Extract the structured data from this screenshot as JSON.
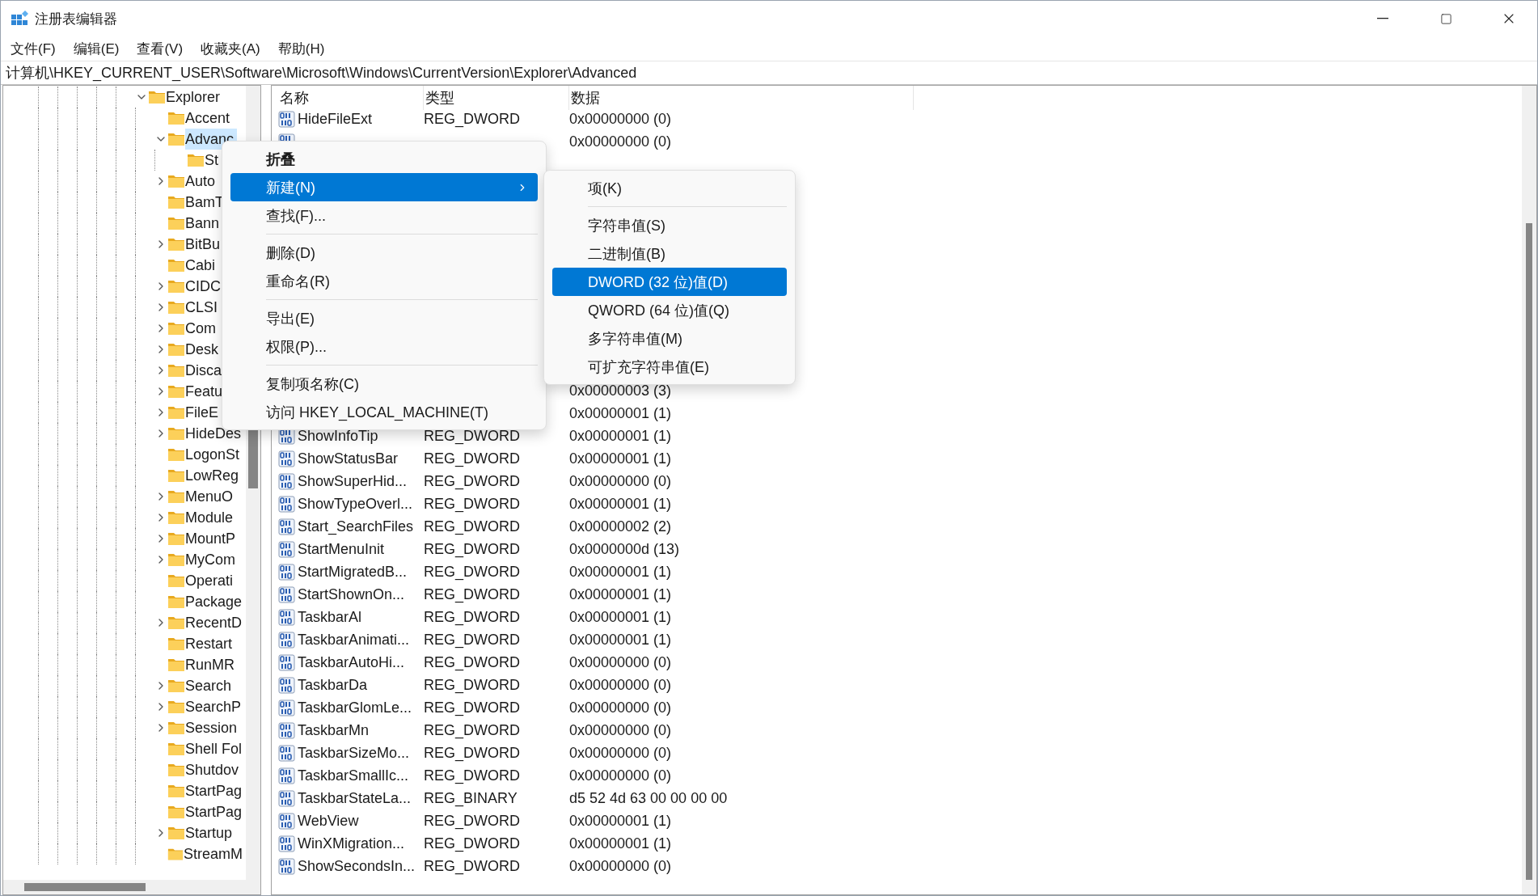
{
  "window": {
    "title": "注册表编辑器"
  },
  "menu_bar": [
    "文件(F)",
    "编辑(E)",
    "查看(V)",
    "收藏夹(A)",
    "帮助(H)"
  ],
  "address": "计算机\\HKEY_CURRENT_USER\\Software\\Microsoft\\Windows\\CurrentVersion\\Explorer\\Advanced",
  "tree": [
    {
      "label": "Explorer",
      "expanded": true,
      "selected": false,
      "children": [
        {
          "label": "Accent",
          "selected": false
        },
        {
          "label": "Advanc",
          "expanded": true,
          "selected": true,
          "children": [
            {
              "label": "St",
              "selected": false
            }
          ]
        },
        {
          "label": "Auto",
          "expanded": false,
          "selected": false
        },
        {
          "label": "BamT",
          "selected": false
        },
        {
          "label": "Bann",
          "selected": false
        },
        {
          "label": "BitBu",
          "expanded": false,
          "selected": false
        },
        {
          "label": "Cabi",
          "selected": false
        },
        {
          "label": "CIDC",
          "expanded": false,
          "selected": false
        },
        {
          "label": "CLSI",
          "expanded": false,
          "selected": false
        },
        {
          "label": "Com",
          "expanded": false,
          "selected": false
        },
        {
          "label": "Desk",
          "expanded": false,
          "selected": false
        },
        {
          "label": "Disca",
          "expanded": false,
          "selected": false
        },
        {
          "label": "Featu",
          "expanded": false,
          "selected": false
        },
        {
          "label": "FileE",
          "expanded": false,
          "selected": false
        },
        {
          "label": "HideDes",
          "expanded": false,
          "selected": false
        },
        {
          "label": "LogonSt",
          "selected": false
        },
        {
          "label": "LowReg",
          "selected": false
        },
        {
          "label": "MenuO",
          "expanded": false,
          "selected": false
        },
        {
          "label": "Module",
          "expanded": false,
          "selected": false
        },
        {
          "label": "MountP",
          "expanded": false,
          "selected": false
        },
        {
          "label": "MyCom",
          "expanded": false,
          "selected": false
        },
        {
          "label": "Operati",
          "selected": false
        },
        {
          "label": "Package",
          "selected": false
        },
        {
          "label": "RecentD",
          "expanded": false,
          "selected": false
        },
        {
          "label": "Restart",
          "selected": false
        },
        {
          "label": "RunMR",
          "selected": false
        },
        {
          "label": "Search",
          "expanded": false,
          "selected": false
        },
        {
          "label": "SearchP",
          "expanded": false,
          "selected": false
        },
        {
          "label": "Session",
          "expanded": false,
          "selected": false
        },
        {
          "label": "Shell Fol",
          "selected": false
        },
        {
          "label": "Shutdov",
          "selected": false
        },
        {
          "label": "StartPag",
          "selected": false
        },
        {
          "label": "StartPag",
          "selected": false
        },
        {
          "label": "Startup",
          "expanded": false,
          "selected": false
        },
        {
          "label": "StreamM",
          "selected": false
        }
      ]
    }
  ],
  "table": {
    "columns": [
      "名称",
      "类型",
      "数据"
    ],
    "rows": [
      {
        "icon": true,
        "name": "HideFileExt",
        "type": "REG_DWORD",
        "data": "0x00000000 (0)"
      },
      {
        "icon": true,
        "data": "0x00000000 (0)"
      },
      {
        "icon": false
      },
      {
        "icon": false
      },
      {
        "icon": false
      },
      {
        "icon": false
      },
      {
        "icon": false
      },
      {
        "icon": false
      },
      {
        "icon": false
      },
      {
        "icon": false
      },
      {
        "icon": false
      },
      {
        "icon": false
      },
      {
        "icon": false,
        "data": "0x00000003 (3)"
      },
      {
        "icon": false,
        "data": "0x00000001 (1)"
      },
      {
        "icon": true,
        "name": "ShowInfoTip",
        "type": "REG_DWORD",
        "data": "0x00000001 (1)"
      },
      {
        "icon": true,
        "name": "ShowStatusBar",
        "type": "REG_DWORD",
        "data": "0x00000001 (1)"
      },
      {
        "icon": true,
        "name": "ShowSuperHid...",
        "type": "REG_DWORD",
        "data": "0x00000000 (0)"
      },
      {
        "icon": true,
        "name": "ShowTypeOverl...",
        "type": "REG_DWORD",
        "data": "0x00000001 (1)"
      },
      {
        "icon": true,
        "name": "Start_SearchFiles",
        "type": "REG_DWORD",
        "data": "0x00000002 (2)"
      },
      {
        "icon": true,
        "name": "StartMenuInit",
        "type": "REG_DWORD",
        "data": "0x0000000d (13)"
      },
      {
        "icon": true,
        "name": "StartMigratedB...",
        "type": "REG_DWORD",
        "data": "0x00000001 (1)"
      },
      {
        "icon": true,
        "name": "StartShownOn...",
        "type": "REG_DWORD",
        "data": "0x00000001 (1)"
      },
      {
        "icon": true,
        "name": "TaskbarAl",
        "type": "REG_DWORD",
        "data": "0x00000001 (1)"
      },
      {
        "icon": true,
        "name": "TaskbarAnimati...",
        "type": "REG_DWORD",
        "data": "0x00000001 (1)"
      },
      {
        "icon": true,
        "name": "TaskbarAutoHi...",
        "type": "REG_DWORD",
        "data": "0x00000000 (0)"
      },
      {
        "icon": true,
        "name": "TaskbarDa",
        "type": "REG_DWORD",
        "data": "0x00000000 (0)"
      },
      {
        "icon": true,
        "name": "TaskbarGlomLe...",
        "type": "REG_DWORD",
        "data": "0x00000000 (0)"
      },
      {
        "icon": true,
        "name": "TaskbarMn",
        "type": "REG_DWORD",
        "data": "0x00000000 (0)"
      },
      {
        "icon": true,
        "name": "TaskbarSizeMo...",
        "type": "REG_DWORD",
        "data": "0x00000000 (0)"
      },
      {
        "icon": true,
        "name": "TaskbarSmallIc...",
        "type": "REG_DWORD",
        "data": "0x00000000 (0)"
      },
      {
        "icon": true,
        "name": "TaskbarStateLa...",
        "type": "REG_BINARY",
        "data": "d5 52 4d 63 00 00 00 00"
      },
      {
        "icon": true,
        "name": "WebView",
        "type": "REG_DWORD",
        "data": "0x00000001 (1)"
      },
      {
        "icon": true,
        "name": "WinXMigration...",
        "type": "REG_DWORD",
        "data": "0x00000001 (1)"
      },
      {
        "icon": true,
        "name": "ShowSecondsIn...",
        "type": "REG_DWORD",
        "data": "0x00000000 (0)"
      }
    ]
  },
  "context_menu": {
    "items": [
      {
        "kind": "header",
        "label": "折叠",
        "selected": false
      },
      {
        "kind": "submenu",
        "label": "新建(N)",
        "selected": true
      },
      {
        "kind": "item",
        "label": "查找(F)...",
        "selected": false
      },
      {
        "kind": "separator"
      },
      {
        "kind": "item",
        "label": "删除(D)",
        "selected": false
      },
      {
        "kind": "item",
        "label": "重命名(R)",
        "selected": false
      },
      {
        "kind": "separator"
      },
      {
        "kind": "item",
        "label": "导出(E)",
        "selected": false
      },
      {
        "kind": "item",
        "label": "权限(P)...",
        "selected": false
      },
      {
        "kind": "separator"
      },
      {
        "kind": "item",
        "label": "复制项名称(C)",
        "selected": false
      },
      {
        "kind": "item",
        "label": "访问 HKEY_LOCAL_MACHINE(T)",
        "selected": false
      }
    ]
  },
  "submenu": {
    "items": [
      {
        "kind": "item",
        "label": "项(K)",
        "selected": false
      },
      {
        "kind": "separator"
      },
      {
        "kind": "item",
        "label": "字符串值(S)",
        "selected": false
      },
      {
        "kind": "item",
        "label": "二进制值(B)",
        "selected": false
      },
      {
        "kind": "item",
        "label": "DWORD (32 位)值(D)",
        "selected": true
      },
      {
        "kind": "item",
        "label": "QWORD (64 位)值(Q)",
        "selected": false
      },
      {
        "kind": "item",
        "label": "多字符串值(M)",
        "selected": false
      },
      {
        "kind": "item",
        "label": "可扩充字符串值(E)",
        "selected": false
      }
    ]
  }
}
